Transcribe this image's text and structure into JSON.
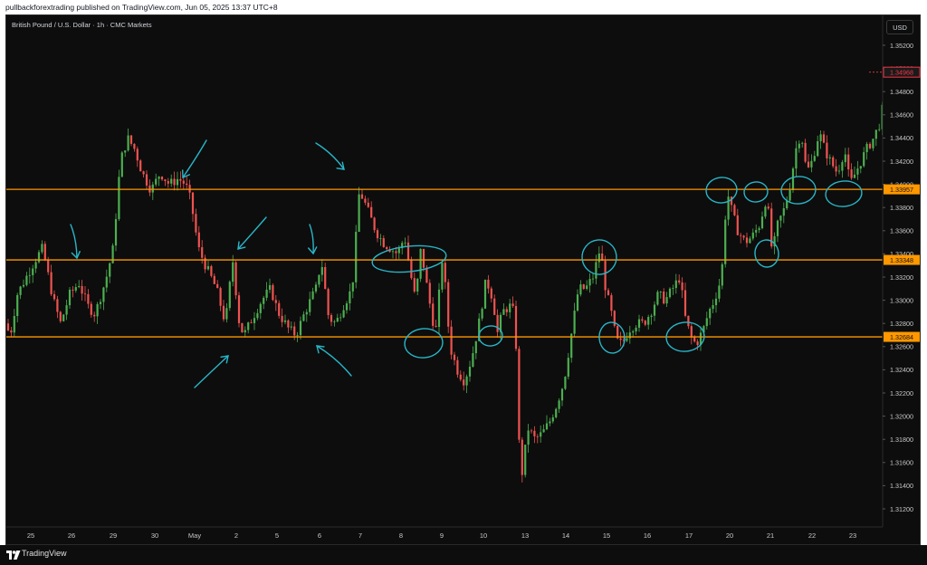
{
  "header": {
    "publish_text": "pullbackforextrading published on TradingView.com, Jun 05, 2025 13:37 UTC+8"
  },
  "symbol_title": "British Pound / U.S. Dollar · 1h · CMC Markets",
  "currency_button": "USD",
  "footer": {
    "brand": "TradingView"
  },
  "colors": {
    "up": "#26a69a",
    "up_candle": "#4caf50",
    "down": "#ef5350",
    "level_line": "#ff9800",
    "annotation": "#29b6c8",
    "current_price": "#f23645"
  },
  "chart_data": {
    "type": "candlestick",
    "symbol": "GBPUSD",
    "timeframe": "1h",
    "source": "CMC Markets",
    "y_axis": {
      "range": [
        1.31,
        1.3536
      ],
      "ticks": [
        "1.35200",
        "1.35000",
        "1.34800",
        "1.34600",
        "1.34400",
        "1.34200",
        "1.34000",
        "1.33800",
        "1.33600",
        "1.33400",
        "1.33200",
        "1.33000",
        "1.32800",
        "1.32600",
        "1.32400",
        "1.32200",
        "1.32000",
        "1.31800",
        "1.31600",
        "1.31400",
        "1.31200"
      ]
    },
    "x_axis": {
      "ticks": [
        "25",
        "26",
        "29",
        "30",
        "May",
        "2",
        "5",
        "6",
        "7",
        "8",
        "9",
        "10",
        "13",
        "14",
        "15",
        "16",
        "17",
        "20",
        "21",
        "22",
        "23"
      ]
    },
    "horizontal_levels": [
      {
        "price": 1.33957,
        "label": "1.33957"
      },
      {
        "price": 1.33348,
        "label": "1.33348"
      },
      {
        "price": 1.32684,
        "label": "1.32684"
      }
    ],
    "current_price": {
      "price": 1.34968,
      "label": "1.34968"
    },
    "price_path": [
      [
        0,
        1.328
      ],
      [
        4,
        1.3268
      ],
      [
        12,
        1.3305
      ],
      [
        22,
        1.332
      ],
      [
        32,
        1.3335
      ],
      [
        40,
        1.3345
      ],
      [
        52,
        1.33
      ],
      [
        60,
        1.328
      ],
      [
        70,
        1.3305
      ],
      [
        80,
        1.3315
      ],
      [
        90,
        1.3295
      ],
      [
        98,
        1.3288
      ],
      [
        110,
        1.3318
      ],
      [
        118,
        1.3345
      ],
      [
        126,
        1.342
      ],
      [
        134,
        1.344
      ],
      [
        142,
        1.343
      ],
      [
        150,
        1.341
      ],
      [
        160,
        1.3395
      ],
      [
        170,
        1.341
      ],
      [
        180,
        1.34
      ],
      [
        190,
        1.3405
      ],
      [
        198,
        1.34
      ],
      [
        204,
        1.3385
      ],
      [
        212,
        1.3345
      ],
      [
        220,
        1.333
      ],
      [
        232,
        1.331
      ],
      [
        242,
        1.328
      ],
      [
        250,
        1.3335
      ],
      [
        258,
        1.3275
      ],
      [
        264,
        1.3272
      ],
      [
        272,
        1.3285
      ],
      [
        282,
        1.33
      ],
      [
        292,
        1.331
      ],
      [
        300,
        1.329
      ],
      [
        312,
        1.3275
      ],
      [
        320,
        1.327
      ],
      [
        330,
        1.329
      ],
      [
        342,
        1.331
      ],
      [
        348,
        1.3335
      ],
      [
        356,
        1.3285
      ],
      [
        364,
        1.328
      ],
      [
        372,
        1.3295
      ],
      [
        382,
        1.331
      ],
      [
        390,
        1.3395
      ],
      [
        398,
        1.338
      ],
      [
        408,
        1.336
      ],
      [
        416,
        1.335
      ],
      [
        424,
        1.3345
      ],
      [
        432,
        1.334
      ],
      [
        440,
        1.3355
      ],
      [
        446,
        1.3325
      ],
      [
        452,
        1.33
      ],
      [
        458,
        1.3345
      ],
      [
        466,
        1.3305
      ],
      [
        474,
        1.327
      ],
      [
        482,
        1.334
      ],
      [
        490,
        1.326
      ],
      [
        498,
        1.324
      ],
      [
        506,
        1.323
      ],
      [
        514,
        1.325
      ],
      [
        522,
        1.328
      ],
      [
        530,
        1.3318
      ],
      [
        538,
        1.33
      ],
      [
        542,
        1.327
      ],
      [
        548,
        1.329
      ],
      [
        556,
        1.3295
      ],
      [
        562,
        1.3288
      ],
      [
        566,
        1.318
      ],
      [
        570,
        1.315
      ],
      [
        576,
        1.319
      ],
      [
        584,
        1.318
      ],
      [
        592,
        1.3185
      ],
      [
        600,
        1.3195
      ],
      [
        608,
        1.321
      ],
      [
        616,
        1.323
      ],
      [
        624,
        1.327
      ],
      [
        632,
        1.331
      ],
      [
        640,
        1.331
      ],
      [
        648,
        1.332
      ],
      [
        656,
        1.3345
      ],
      [
        662,
        1.331
      ],
      [
        668,
        1.329
      ],
      [
        674,
        1.3265
      ],
      [
        680,
        1.3262
      ],
      [
        688,
        1.3275
      ],
      [
        696,
        1.328
      ],
      [
        704,
        1.328
      ],
      [
        712,
        1.329
      ],
      [
        720,
        1.3305
      ],
      [
        728,
        1.33
      ],
      [
        736,
        1.331
      ],
      [
        744,
        1.332
      ],
      [
        750,
        1.3285
      ],
      [
        756,
        1.3268
      ],
      [
        762,
        1.3262
      ],
      [
        770,
        1.3275
      ],
      [
        776,
        1.329
      ],
      [
        782,
        1.33
      ],
      [
        790,
        1.332
      ],
      [
        796,
        1.3395
      ],
      [
        802,
        1.3375
      ],
      [
        808,
        1.336
      ],
      [
        816,
        1.335
      ],
      [
        824,
        1.3355
      ],
      [
        832,
        1.3365
      ],
      [
        840,
        1.339
      ],
      [
        846,
        1.334
      ],
      [
        852,
        1.3365
      ],
      [
        860,
        1.338
      ],
      [
        866,
        1.34
      ],
      [
        872,
        1.343
      ],
      [
        878,
        1.3445
      ],
      [
        884,
        1.341
      ],
      [
        890,
        1.342
      ],
      [
        898,
        1.3445
      ],
      [
        904,
        1.343
      ],
      [
        910,
        1.342
      ],
      [
        918,
        1.341
      ],
      [
        926,
        1.343
      ],
      [
        932,
        1.34
      ],
      [
        938,
        1.341
      ],
      [
        944,
        1.342
      ],
      [
        950,
        1.343
      ],
      [
        958,
        1.344
      ],
      [
        966,
        1.3455
      ],
      [
        972,
        1.349
      ],
      [
        976,
        1.3497
      ]
    ]
  }
}
